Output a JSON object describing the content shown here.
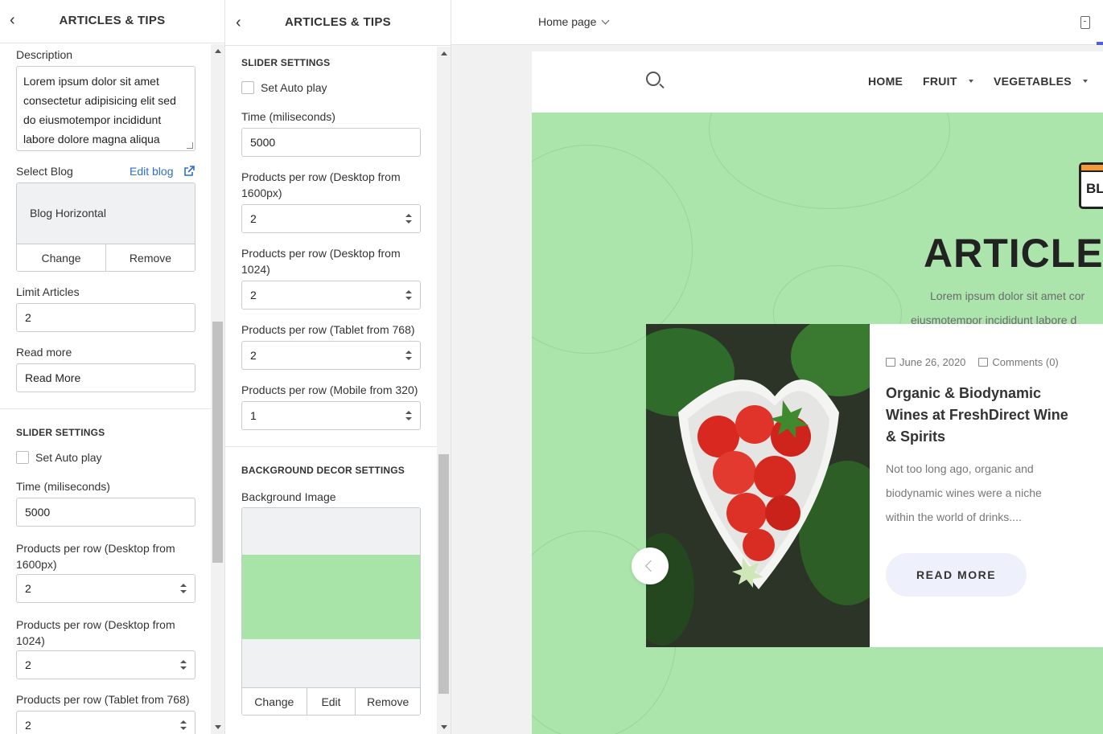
{
  "panel1": {
    "header": {
      "title": "ARTICLES & TIPS"
    },
    "description": {
      "label": "Description",
      "value": "Lorem ipsum dolor sit amet consectetur adipisicing elit sed do eiusmotempor incididunt labore dolore magna aliqua"
    },
    "select_blog": {
      "label": "Select Blog",
      "edit_link": "Edit blog",
      "selected": "Blog Horizontal",
      "change": "Change",
      "remove": "Remove"
    },
    "limit_articles": {
      "label": "Limit Articles",
      "value": "2"
    },
    "read_more": {
      "label": "Read more",
      "value": "Read More"
    },
    "slider": {
      "title": "SLIDER SETTINGS",
      "autoplay_label": "Set Auto play",
      "autoplay_checked": false,
      "time_label": "Time (miliseconds)",
      "time_value": "5000",
      "desktop1600_label": "Products per row (Desktop from 1600px)",
      "desktop1600_value": "2",
      "desktop1024_label": "Products per row (Desktop from 1024)",
      "desktop1024_value": "2",
      "tablet_label": "Products per row (Tablet from 768)",
      "tablet_value": "2"
    }
  },
  "panel2": {
    "header": {
      "title": "ARTICLES & TIPS"
    },
    "slider": {
      "title": "SLIDER SETTINGS",
      "autoplay_label": "Set Auto play",
      "autoplay_checked": false,
      "time_label": "Time (miliseconds)",
      "time_value": "5000",
      "desktop1600_label": "Products per row (Desktop from 1600px)",
      "desktop1600_value": "2",
      "desktop1024_label": "Products per row (Desktop from 1024)",
      "desktop1024_value": "2",
      "tablet_label": "Products per row (Tablet from 768)",
      "tablet_value": "2",
      "mobile_label": "Products per row (Mobile from 320)",
      "mobile_value": "1"
    },
    "bg_decor": {
      "title": "BACKGROUND DECOR SETTINGS",
      "image_label": "Background Image",
      "change": "Change",
      "edit": "Edit",
      "remove": "Remove"
    }
  },
  "preview": {
    "page_select": "Home page",
    "nav": {
      "home": "HOME",
      "fruit": "FRUIT",
      "vegetables": "VEGETABLES"
    },
    "badge_text": "BL",
    "hero": {
      "title": "ARTICLE",
      "desc_line1": "Lorem ipsum dolor sit amet cor",
      "desc_line2": "eiusmotempor incididunt labore d"
    },
    "card": {
      "date": "June 26, 2020",
      "comments": "Comments (0)",
      "title": "Organic & Biodynamic Wines at FreshDirect Wine & Spirits",
      "excerpt": "Not too long ago, organic and biodynamic wines were a niche within the world of drinks....",
      "button": "READ MORE"
    }
  },
  "colors": {
    "hero_bg": "#abe5ac",
    "link": "#2c6ecb",
    "button_bg": "#eef1fb",
    "badge_accent": "#f29a3a"
  }
}
